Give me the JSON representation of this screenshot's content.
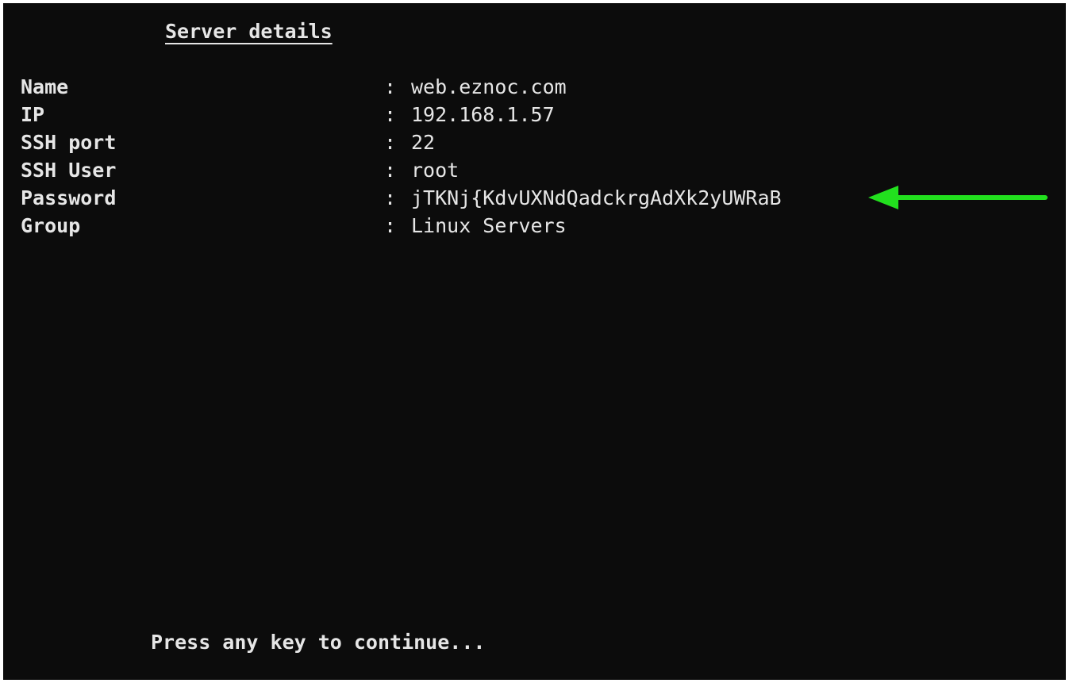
{
  "screen": {
    "title": "Server details",
    "rows": [
      {
        "label": "Name",
        "separator": ":",
        "value": "web.eznoc.com"
      },
      {
        "label": "IP",
        "separator": ":",
        "value": "192.168.1.57"
      },
      {
        "label": "SSH port",
        "separator": ":",
        "value": "22"
      },
      {
        "label": "SSH User",
        "separator": ":",
        "value": "root"
      },
      {
        "label": "Password",
        "separator": ":",
        "value": "jTKNj{KdvUXNdQadckrgAdXk2yUWRaB"
      },
      {
        "label": "Group",
        "separator": ":",
        "value": "Linux Servers"
      }
    ],
    "prompt": "Press any key to continue..."
  },
  "annotation": {
    "arrow_icon": "left-arrow-icon",
    "arrow_color": "#22e01e"
  },
  "colors": {
    "background": "#0c0c0c",
    "text": "#e6e6e6",
    "frame": "#ffffff"
  }
}
